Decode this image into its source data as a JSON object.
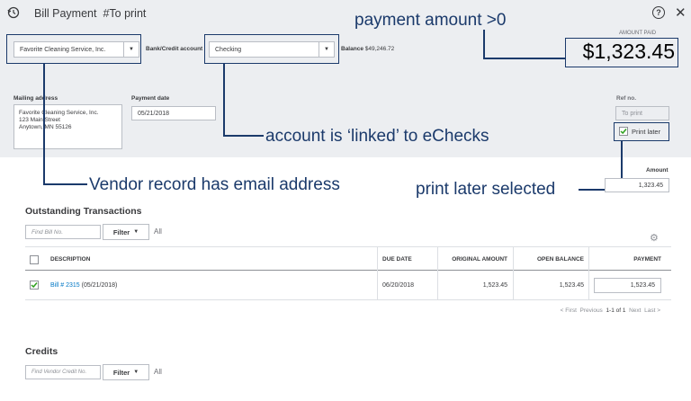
{
  "header": {
    "title": "Bill Payment",
    "subtitle": "#To print"
  },
  "payee": {
    "value": "Favorite Cleaning Service, Inc."
  },
  "bank_account": {
    "label": "Bank/Credit account",
    "value": "Checking",
    "balance_label": "Balance",
    "balance_value": "$49,246.72"
  },
  "amount_paid": {
    "label": "AMOUNT PAID",
    "value": "$1,323.45"
  },
  "mailing": {
    "label": "Mailing address",
    "lines": [
      "Favorite Cleaning Service, Inc.",
      "123 Main Street",
      "Anytown, MN  55126"
    ]
  },
  "payment_date": {
    "label": "Payment date",
    "value": "05/21/2018"
  },
  "ref": {
    "label": "Ref no.",
    "placeholder": "To print",
    "print_later_label": "Print later"
  },
  "amount": {
    "label": "Amount",
    "value": "1,323.45"
  },
  "annotations": {
    "payment": "payment amount >0",
    "account": "account is ‘linked’ to eChecks",
    "vendor": "Vendor record has email address",
    "print": "print later selected"
  },
  "outstanding": {
    "title": "Outstanding Transactions",
    "search_placeholder": "Find Bill No.",
    "filter_label": "Filter",
    "all_label": "All",
    "columns": [
      "DESCRIPTION",
      "DUE DATE",
      "ORIGINAL AMOUNT",
      "OPEN BALANCE",
      "PAYMENT"
    ],
    "rows": [
      {
        "link": "Bill # 2315",
        "date": "(05/21/2018)",
        "due": "06/20/2018",
        "original": "1,523.45",
        "open": "1,523.45",
        "payment": "1,523.45"
      }
    ],
    "pagination": {
      "first": "< First",
      "previous": "Previous",
      "range": "1-1 of 1",
      "next": "Next",
      "last": "Last >"
    }
  },
  "credits": {
    "title": "Credits",
    "search_placeholder": "Find Vendor Credit No.",
    "filter_label": "Filter",
    "all_label": "All"
  },
  "colors": {
    "annotation": "#1b3a6b",
    "link": "#0077c5",
    "check": "#2ca01c"
  }
}
